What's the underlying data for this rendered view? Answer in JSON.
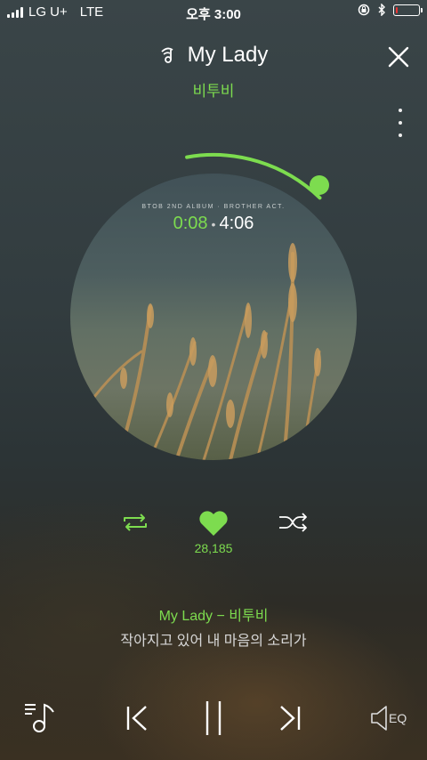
{
  "status": {
    "carrier": "LG U+",
    "network": "LTE",
    "time": "오후 3:00",
    "battery_level": 0.1
  },
  "track": {
    "title": "My Lady",
    "artist": "비투비",
    "album_caption": "BTOB 2ND ALBUM · BROTHER ACT."
  },
  "playback": {
    "current_time": "0:08",
    "total_time": "4:06",
    "progress": 0.033
  },
  "likes": {
    "count": "28,185"
  },
  "lyrics": {
    "title_line": "My Lady − 비투비",
    "current_line": "작아지고 있어 내 마음의 소리가"
  },
  "icons": {
    "music_note": "music-note-icon",
    "close": "close-icon",
    "more": "more-vertical-icon",
    "repeat": "repeat-icon",
    "heart": "heart-icon",
    "shuffle": "shuffle-icon",
    "playlist": "playlist-icon",
    "previous": "previous-icon",
    "pause": "pause-icon",
    "next": "next-icon",
    "eq": "eq-icon"
  },
  "eq_label": "EQ",
  "colors": {
    "accent": "#7ddc4f",
    "background": "#323c3f"
  }
}
